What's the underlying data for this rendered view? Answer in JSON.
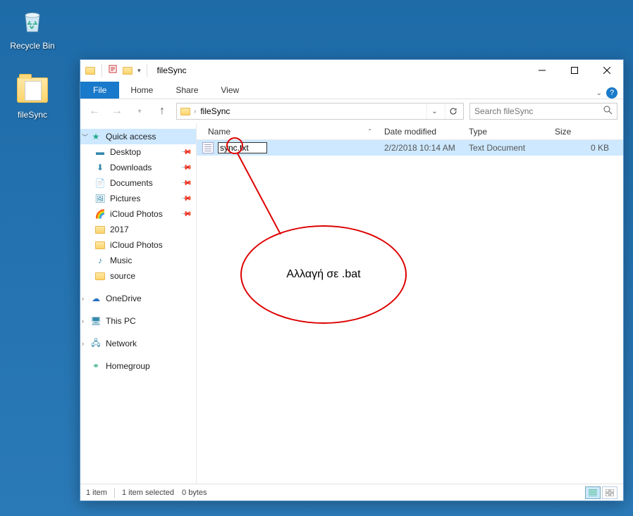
{
  "desktop": {
    "recycle": "Recycle Bin",
    "filesync": "fileSync"
  },
  "window": {
    "title": "fileSync",
    "menu": {
      "file": "File",
      "home": "Home",
      "share": "Share",
      "view": "View"
    },
    "address": {
      "crumb": "fileSync",
      "search_placeholder": "Search fileSync"
    },
    "sidebar": {
      "quick": "Quick access",
      "items": [
        {
          "label": "Desktop",
          "pinned": true
        },
        {
          "label": "Downloads",
          "pinned": true
        },
        {
          "label": "Documents",
          "pinned": true
        },
        {
          "label": "Pictures",
          "pinned": true
        },
        {
          "label": "iCloud Photos",
          "pinned": true
        },
        {
          "label": "2017",
          "pinned": false
        },
        {
          "label": "iCloud Photos",
          "pinned": false
        },
        {
          "label": "Music",
          "pinned": false
        },
        {
          "label": "source",
          "pinned": false
        }
      ],
      "onedrive": "OneDrive",
      "thispc": "This PC",
      "network": "Network",
      "homegroup": "Homegroup"
    },
    "columns": {
      "name": "Name",
      "date": "Date modified",
      "type": "Type",
      "size": "Size"
    },
    "files": [
      {
        "name": "sync.txt",
        "date": "2/2/2018 10:14 AM",
        "type": "Text Document",
        "size": "0 KB"
      }
    ],
    "rename_value": "sync.txt",
    "status": {
      "count": "1 item",
      "selected": "1 item selected",
      "bytes": "0 bytes"
    },
    "annotation": "Αλλαγή σε .bat"
  }
}
